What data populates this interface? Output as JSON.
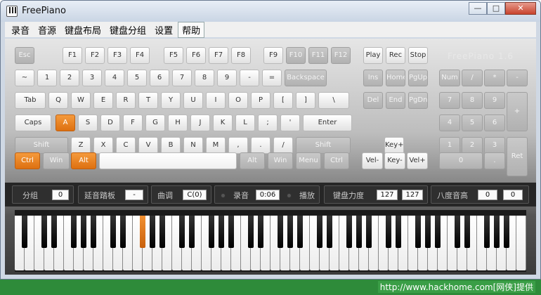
{
  "window": {
    "title": "FreePiano",
    "minimize": "—",
    "maximize": "□",
    "close": "✕"
  },
  "menu": [
    "录音",
    "音源",
    "键盘布局",
    "键盘分组",
    "设置",
    "帮助"
  ],
  "brand": "FreePiano 1.6",
  "keys": {
    "row0": [
      "Esc",
      "F1",
      "F2",
      "F3",
      "F4",
      "F5",
      "F6",
      "F7",
      "F8",
      "F9",
      "F10",
      "F11",
      "F12",
      "Play",
      "Rec",
      "Stop"
    ],
    "row1": [
      "~",
      "1",
      "2",
      "3",
      "4",
      "5",
      "6",
      "7",
      "8",
      "9",
      "-",
      "=",
      "Backspace",
      "Ins",
      "Home",
      "PgUp",
      "Num",
      "/",
      "*",
      "-"
    ],
    "row2": [
      "Tab",
      "Q",
      "W",
      "E",
      "R",
      "T",
      "Y",
      "U",
      "I",
      "O",
      "P",
      "[",
      "]",
      "\\",
      "Del",
      "End",
      "PgDn",
      "7",
      "8",
      "9",
      "+"
    ],
    "row3": [
      "Caps",
      "A",
      "S",
      "D",
      "F",
      "G",
      "H",
      "J",
      "K",
      "L",
      ";",
      "'",
      "Enter",
      "4",
      "5",
      "6"
    ],
    "row4": [
      "Shift",
      "Z",
      "X",
      "C",
      "V",
      "B",
      "N",
      "M",
      ",",
      ".",
      "/",
      "Shift",
      "Key+",
      "1",
      "2",
      "3",
      "Ret"
    ],
    "row5": [
      "Ctrl",
      "Win",
      "Alt",
      "",
      "Alt",
      "Win",
      "Menu",
      "Ctrl",
      "Vel-",
      "Key-",
      "Vel+",
      "0",
      "."
    ]
  },
  "status": {
    "group_label": "分组",
    "group_value": "0",
    "sustain_label": "延音踏板",
    "sustain_value": "-",
    "song_label": "曲调",
    "song_value": "C(0)",
    "record_label": "录音",
    "record_time": "0:06",
    "play_label": "播放",
    "velocity_label": "键盘力度",
    "velocity_a": "127",
    "velocity_b": "127",
    "octave_label": "八度音高",
    "octave_a": "0",
    "octave_b": "0"
  },
  "piano": {
    "white_keys": 52,
    "pressed_black_index": 8
  },
  "footer": "http://www.hackhome.com[网侠]提供",
  "colors": {
    "accent": "#dd7010",
    "panel_dark": "#262626",
    "footer_green": "#2e8b3a"
  }
}
